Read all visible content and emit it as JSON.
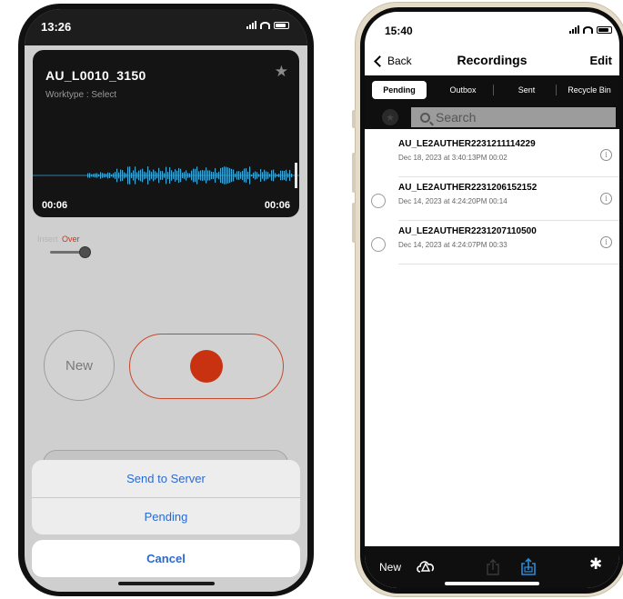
{
  "left": {
    "status": {
      "time": "13:26"
    },
    "recording": {
      "title": "AU_L0010_3150",
      "worktype": "Worktype : Select",
      "time_left": "00:06",
      "time_right": "00:06"
    },
    "mode": {
      "insert": "Insert",
      "over": "Over"
    },
    "controls": {
      "new_label": "New"
    },
    "action_sheet": {
      "items": [
        "Send to Server",
        "Pending"
      ],
      "cancel": "Cancel"
    },
    "colors": {
      "accent": "#2a6ad0",
      "record": "#c83211",
      "waveform": "#3fa7d6"
    }
  },
  "right": {
    "status": {
      "time": "15:40"
    },
    "nav": {
      "back": "Back",
      "title": "Recordings",
      "edit": "Edit"
    },
    "tabs": [
      "Pending",
      "Outbox",
      "Sent",
      "Recycle Bin"
    ],
    "active_tab": "Pending",
    "search": {
      "placeholder": "Search"
    },
    "recordings": [
      {
        "name": "AU_LE2AUTHER2231211114229",
        "meta": "Dec 18, 2023 at 3:40:13PM  00:02"
      },
      {
        "name": "AU_LE2AUTHER2231206152152",
        "meta": "Dec 14, 2023 at 4:24:20PM  00:14"
      },
      {
        "name": "AU_LE2AUTHER2231207110500",
        "meta": "Dec 14, 2023 at 4:24:07PM  00:33"
      }
    ],
    "toolbar": {
      "new_label": "New",
      "icons": [
        "cloud-icon",
        "share-icon",
        "share-active-icon",
        "gear-icon"
      ]
    }
  }
}
